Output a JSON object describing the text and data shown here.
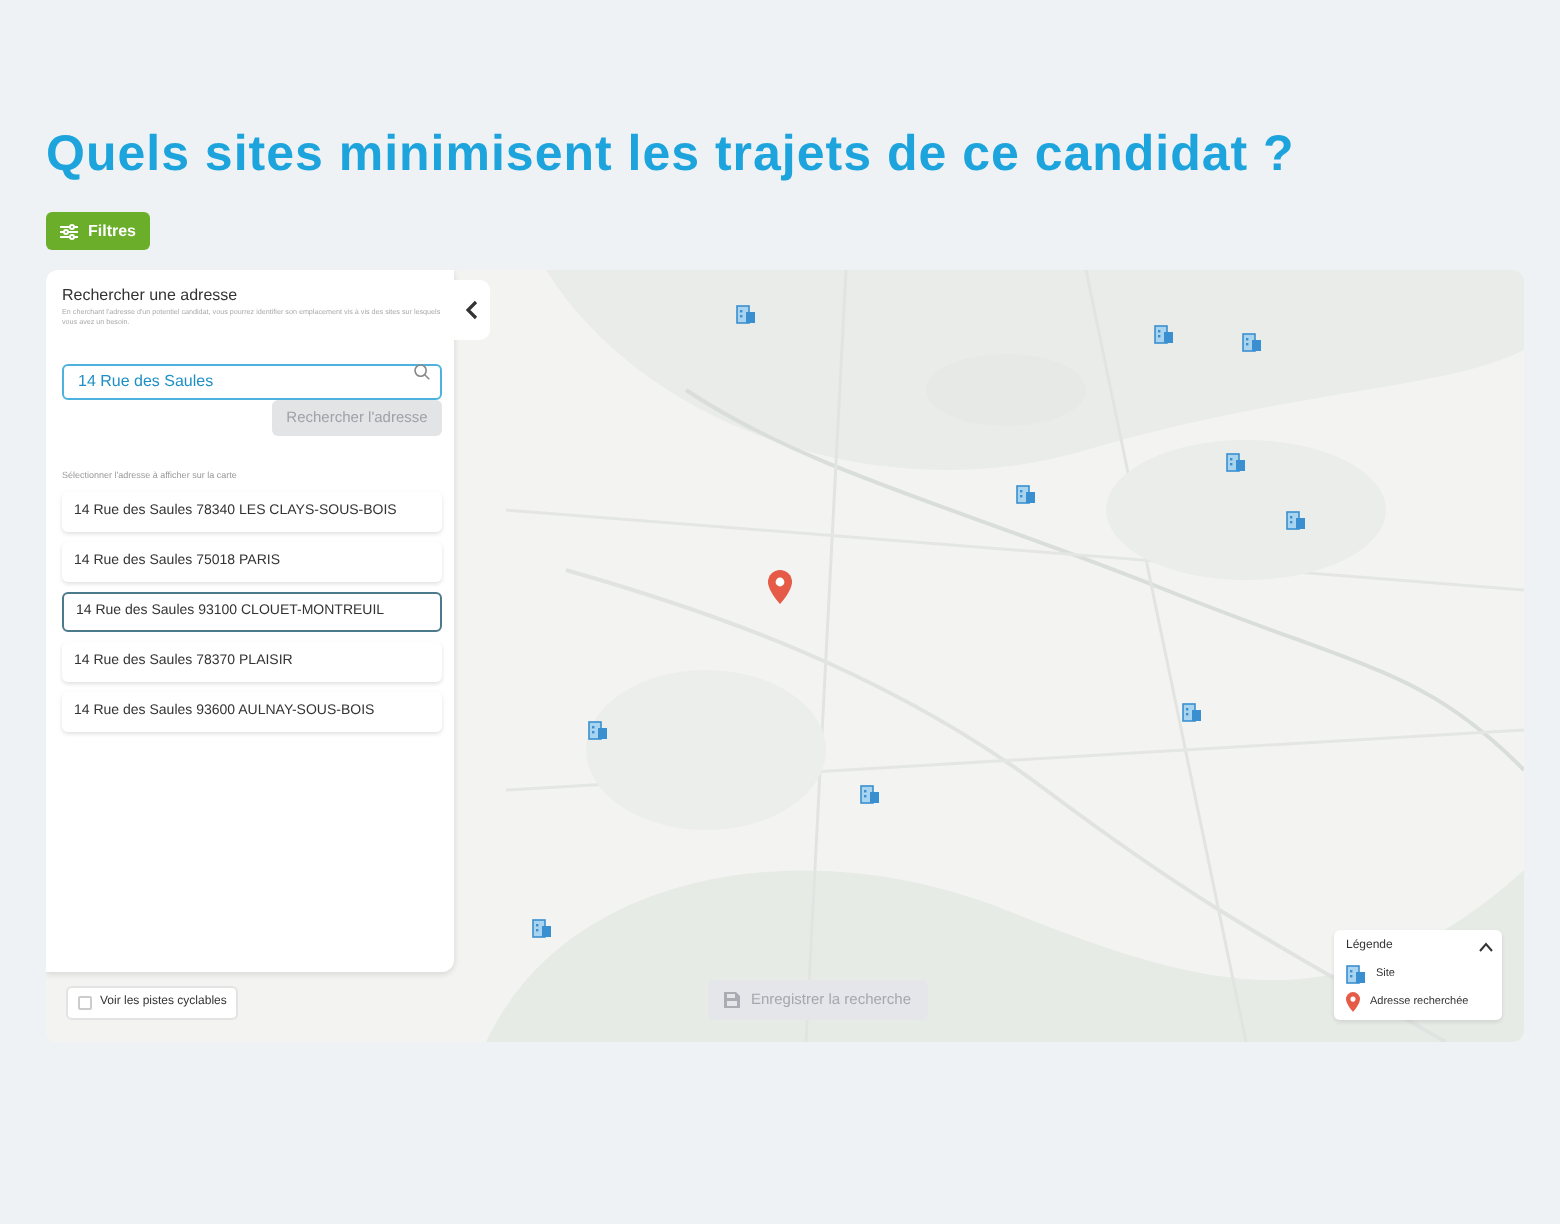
{
  "heading": "Quels sites minimisent les trajets de ce candidat ?",
  "filters_button": "Filtres",
  "search_panel": {
    "title": "Rechercher une adresse",
    "description": "En cherchant l'adresse d'un potentiel candidat, vous pourrez identifier son emplacement vis à vis des sites sur lesquels vous avez un besoin.",
    "search_field": {
      "value": "14 Rue des Saules"
    },
    "search_button": {
      "label": "Rechercher l'adresse",
      "disabled": true
    },
    "results_label": "Sélectionner l'adresse à afficher sur la carte",
    "results": [
      {
        "label": "14 Rue des Saules 78340 LES CLAYS-SOUS-BOIS",
        "selected": false
      },
      {
        "label": "14 Rue des Saules 75018 PARIS",
        "selected": false
      },
      {
        "label": "14 Rue des Saules 93100 CLOUET-MONTREUIL",
        "selected": true
      },
      {
        "label": "14 Rue des Saules 78370 PLAISIR",
        "selected": false
      },
      {
        "label": "14 Rue des Saules 93600 AULNAY-SOUS-BOIS",
        "selected": false
      }
    ]
  },
  "bike_lanes": {
    "label": "Voir les pistes cyclables",
    "checked": false
  },
  "save_button": {
    "label": "Enregistrer la recherche",
    "disabled": true
  },
  "legend": {
    "title": "Légende",
    "expanded": true,
    "items": [
      {
        "kind": "site",
        "label": "Site"
      },
      {
        "kind": "address",
        "label": "Adresse recherchée"
      }
    ]
  }
}
